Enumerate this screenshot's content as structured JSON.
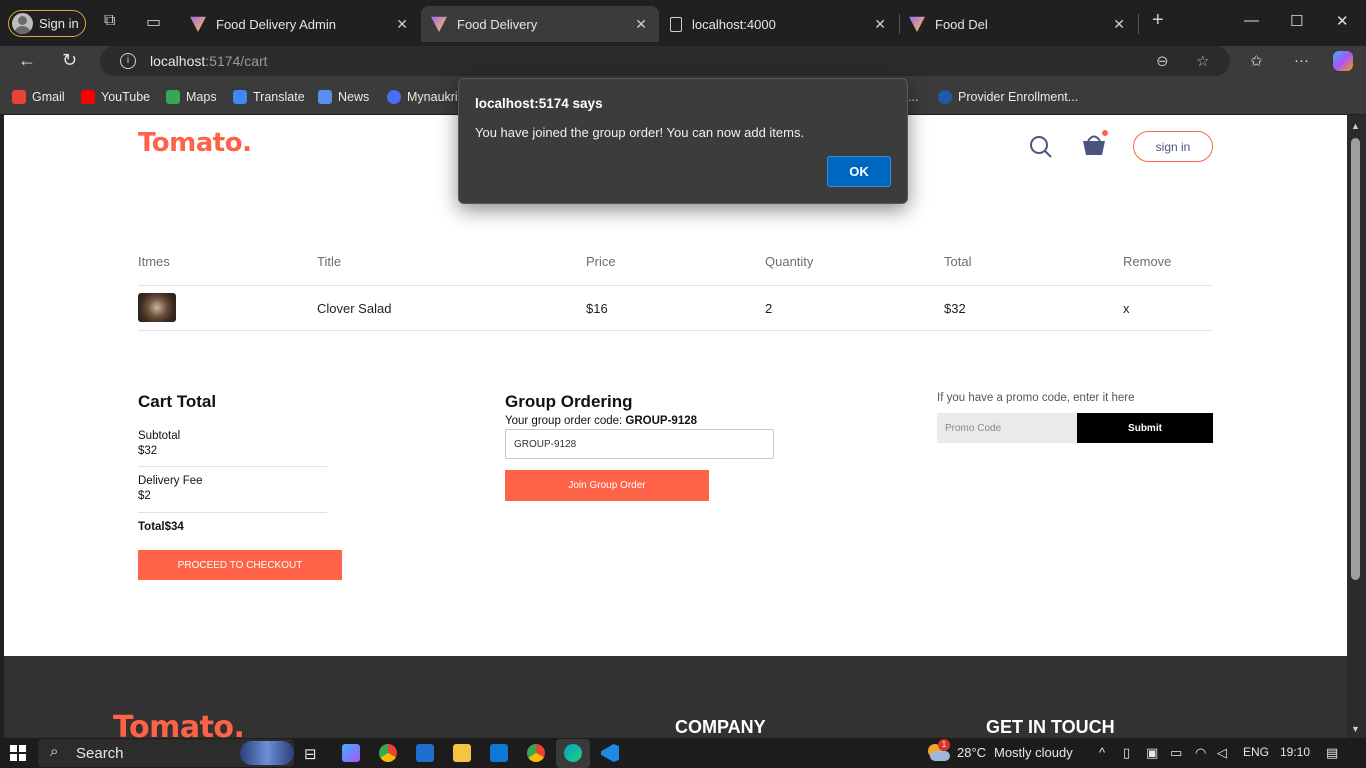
{
  "browser": {
    "signin_label": "Sign in",
    "tabs": [
      {
        "label": "Food Delivery Admin",
        "favicon": "vite-icon"
      },
      {
        "label": "Food Delivery",
        "favicon": "vite-icon",
        "active": true
      },
      {
        "label": "localhost:4000",
        "favicon": "document-icon"
      },
      {
        "label": "Food Del",
        "favicon": "vite-icon"
      }
    ],
    "url_host": "localhost",
    "url_rest": ":5174/cart",
    "bookmarks": [
      "Gmail",
      "YouTube",
      "Maps",
      "Translate",
      "News",
      "Mynaukri",
      "...",
      "Provider Enrollment..."
    ]
  },
  "dialog": {
    "title": "localhost:5174 says",
    "message": "You have joined the group order! You can now add items.",
    "ok_label": "OK"
  },
  "header": {
    "logo": "Tomato.",
    "signin_label": "sign in",
    "accent_color": "#ff6347"
  },
  "cart": {
    "columns": [
      "Itmes",
      "Title",
      "Price",
      "Quantity",
      "Total",
      "Remove"
    ],
    "items": [
      {
        "title": "Clover Salad",
        "price": "$16",
        "quantity": "2",
        "total": "$32",
        "remove": "x"
      }
    ]
  },
  "totals": {
    "heading": "Cart Total",
    "subtotal_label": "Subtotal",
    "subtotal_value": "$32",
    "delivery_label": "Delivery Fee",
    "delivery_value": "$2",
    "total_label": "Total",
    "total_value": "$34",
    "checkout_label": "PROCEED TO CHECKOUT"
  },
  "group": {
    "heading": "Group Ordering",
    "code_label": "Your group order code: ",
    "code_value": "GROUP-9128",
    "input_value": "GROUP-9128",
    "join_label": "Join Group Order"
  },
  "promo": {
    "hint": "If you have a promo code, enter it here",
    "placeholder": "Promo Code",
    "submit_label": "Submit"
  },
  "footer": {
    "logo": "Tomato.",
    "company_heading": "COMPANY",
    "contact_heading": "GET IN TOUCH"
  },
  "taskbar": {
    "search_label": "Search",
    "weather_temp": "28°C",
    "weather_text": "Mostly cloudy",
    "weather_badge": "1",
    "language": "ENG",
    "time": "19:10"
  }
}
